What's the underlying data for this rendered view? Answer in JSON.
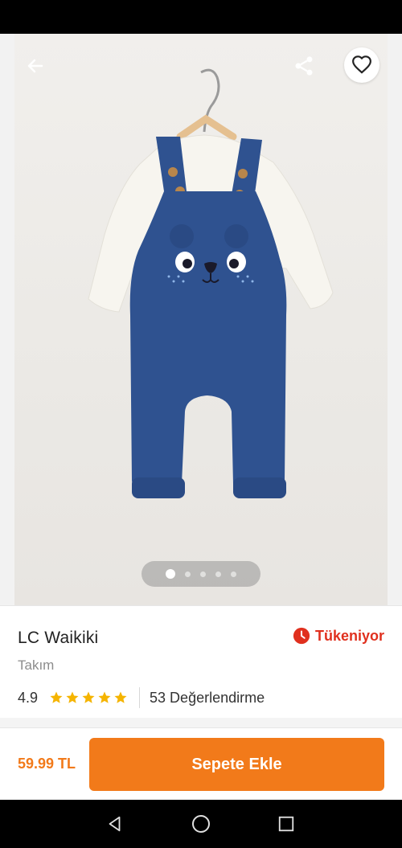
{
  "header": {
    "back_icon": "arrow-left-icon",
    "share_icon": "share-icon",
    "favorite_icon": "heart-outline-icon"
  },
  "gallery": {
    "image_count": 5,
    "active_index": 0
  },
  "product": {
    "brand": "LC Waikiki",
    "category": "Takım",
    "stock_status": "Tükeniyor",
    "stock_icon": "clock-icon",
    "rating": "4.9",
    "stars": 5,
    "reviews": "53 Değerlendirme"
  },
  "purchase": {
    "price": "59.99 TL",
    "cart_label": "Sepete Ekle"
  },
  "colors": {
    "accent": "#f27a1a",
    "stock": "#e0301e",
    "star": "#f5b400",
    "overall_blue": "#2f5290"
  },
  "system_nav": {
    "back_icon": "nav-back-icon",
    "home_icon": "nav-home-icon",
    "recents_icon": "nav-recents-icon"
  }
}
